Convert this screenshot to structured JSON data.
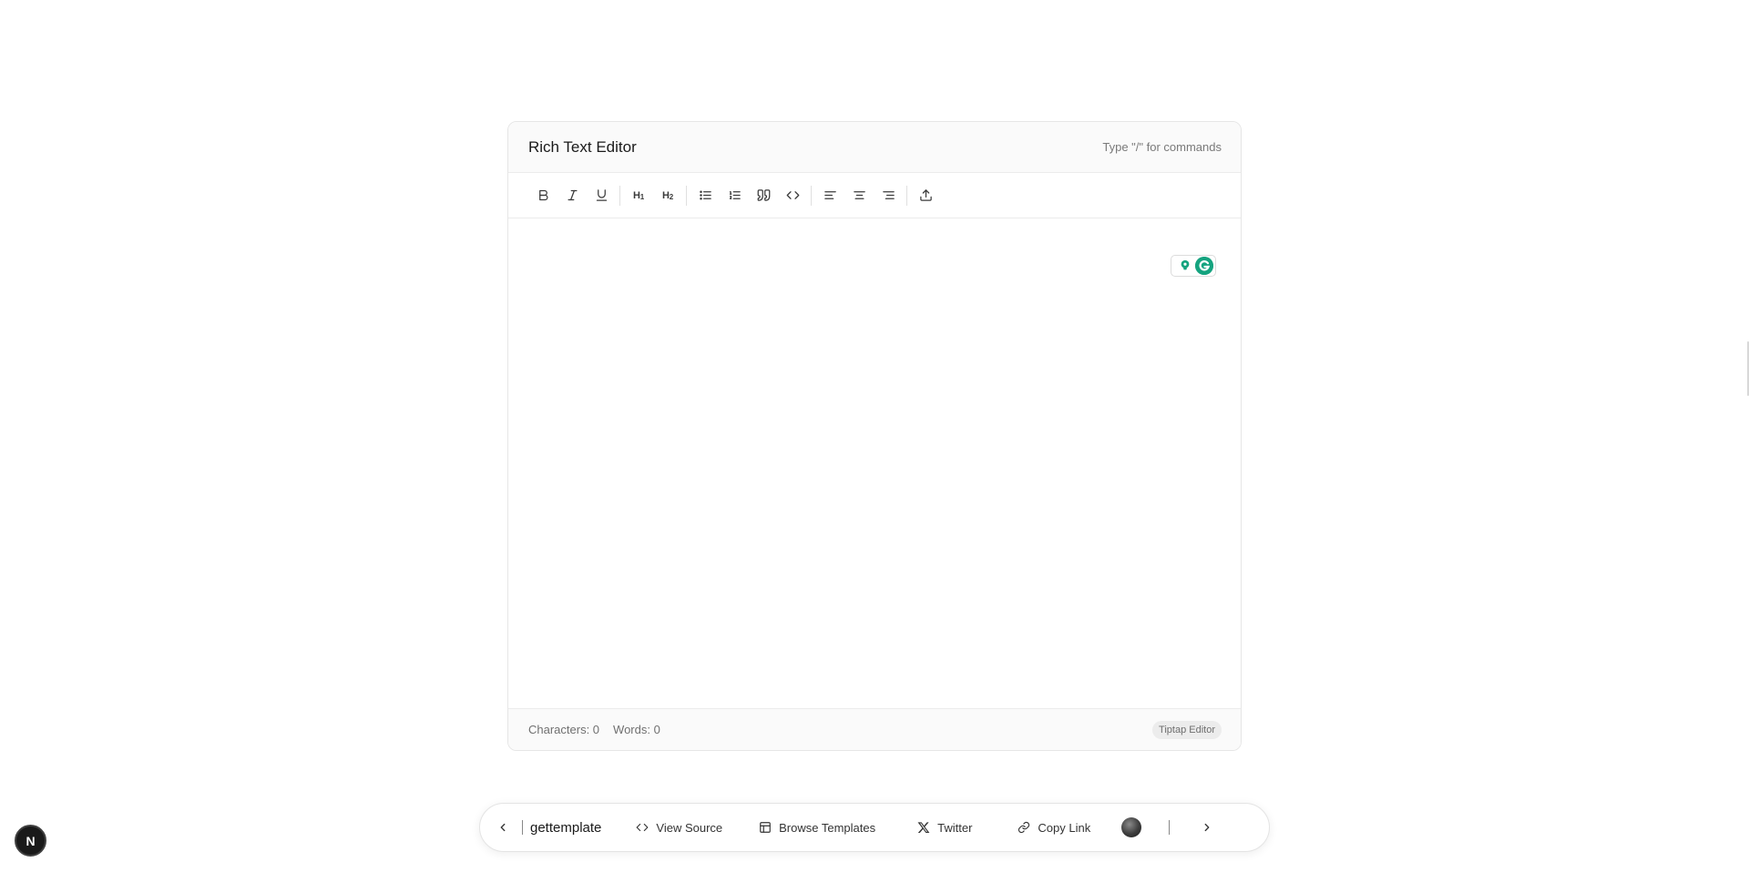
{
  "editor": {
    "title": "Rich Text Editor",
    "hint": "Type \"/\" for commands",
    "toolbar": [
      {
        "name": "bold",
        "icon": "bold-icon"
      },
      {
        "name": "italic",
        "icon": "italic-icon"
      },
      {
        "name": "underline",
        "icon": "underline-icon"
      },
      {
        "name": "heading-1",
        "icon": "heading-1-icon",
        "label": "H",
        "sub": "1"
      },
      {
        "name": "heading-2",
        "icon": "heading-2-icon",
        "label": "H",
        "sub": "2"
      },
      {
        "name": "bullet-list",
        "icon": "bullet-list-icon"
      },
      {
        "name": "ordered-list",
        "icon": "ordered-list-icon"
      },
      {
        "name": "blockquote",
        "icon": "quote-icon"
      },
      {
        "name": "code",
        "icon": "code-icon"
      },
      {
        "name": "align-left",
        "icon": "align-left-icon"
      },
      {
        "name": "align-center",
        "icon": "align-center-icon"
      },
      {
        "name": "align-right",
        "icon": "align-right-icon"
      },
      {
        "name": "upload",
        "icon": "upload-icon"
      }
    ],
    "content": "",
    "footer": {
      "characters": "Characters: 0",
      "words": "Words: 0",
      "badge": "Tiptap Editor"
    }
  },
  "bottom_bar": {
    "brand": "gettemplate",
    "items": [
      {
        "label": "View Source",
        "icon": "code-icon"
      },
      {
        "label": "Browse Templates",
        "icon": "layout-icon"
      },
      {
        "label": "Twitter",
        "icon": "x-logo-icon"
      },
      {
        "label": "Copy Link",
        "icon": "link-icon"
      }
    ]
  },
  "corner_badge": {
    "letter": "N"
  },
  "colors": {
    "grammarly_green": "#15a37f",
    "badge_bg": "#ececec",
    "dark_badge": "#1a1a1a"
  }
}
